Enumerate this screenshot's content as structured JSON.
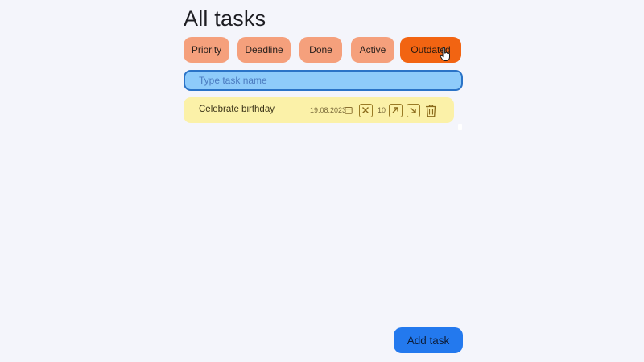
{
  "page": {
    "title": "All tasks"
  },
  "filters": [
    {
      "label": "Priority",
      "active": false
    },
    {
      "label": "Deadline",
      "active": false
    },
    {
      "label": "Done",
      "active": false
    },
    {
      "label": "Active",
      "active": false
    },
    {
      "label": "Outdated",
      "active": true
    }
  ],
  "search": {
    "placeholder": "Type task name",
    "value": ""
  },
  "tasks": [
    {
      "name": "Celebrate birthday",
      "done": true,
      "date": "19.08.2023",
      "priority": "10",
      "icons": [
        "calendar-icon",
        "close-icon",
        "arrow-up-right-icon",
        "arrow-down-right-icon",
        "trash-icon"
      ]
    }
  ],
  "actions": {
    "add_task_label": "Add task"
  },
  "colors": {
    "background": "#f4f5fb",
    "filter": "#f5a07c",
    "filter_active": "#f26412",
    "search_bg": "#8ecbfa",
    "search_border": "#2a73c7",
    "task_bg": "#fbf1a8",
    "accent": "#2379ee"
  }
}
